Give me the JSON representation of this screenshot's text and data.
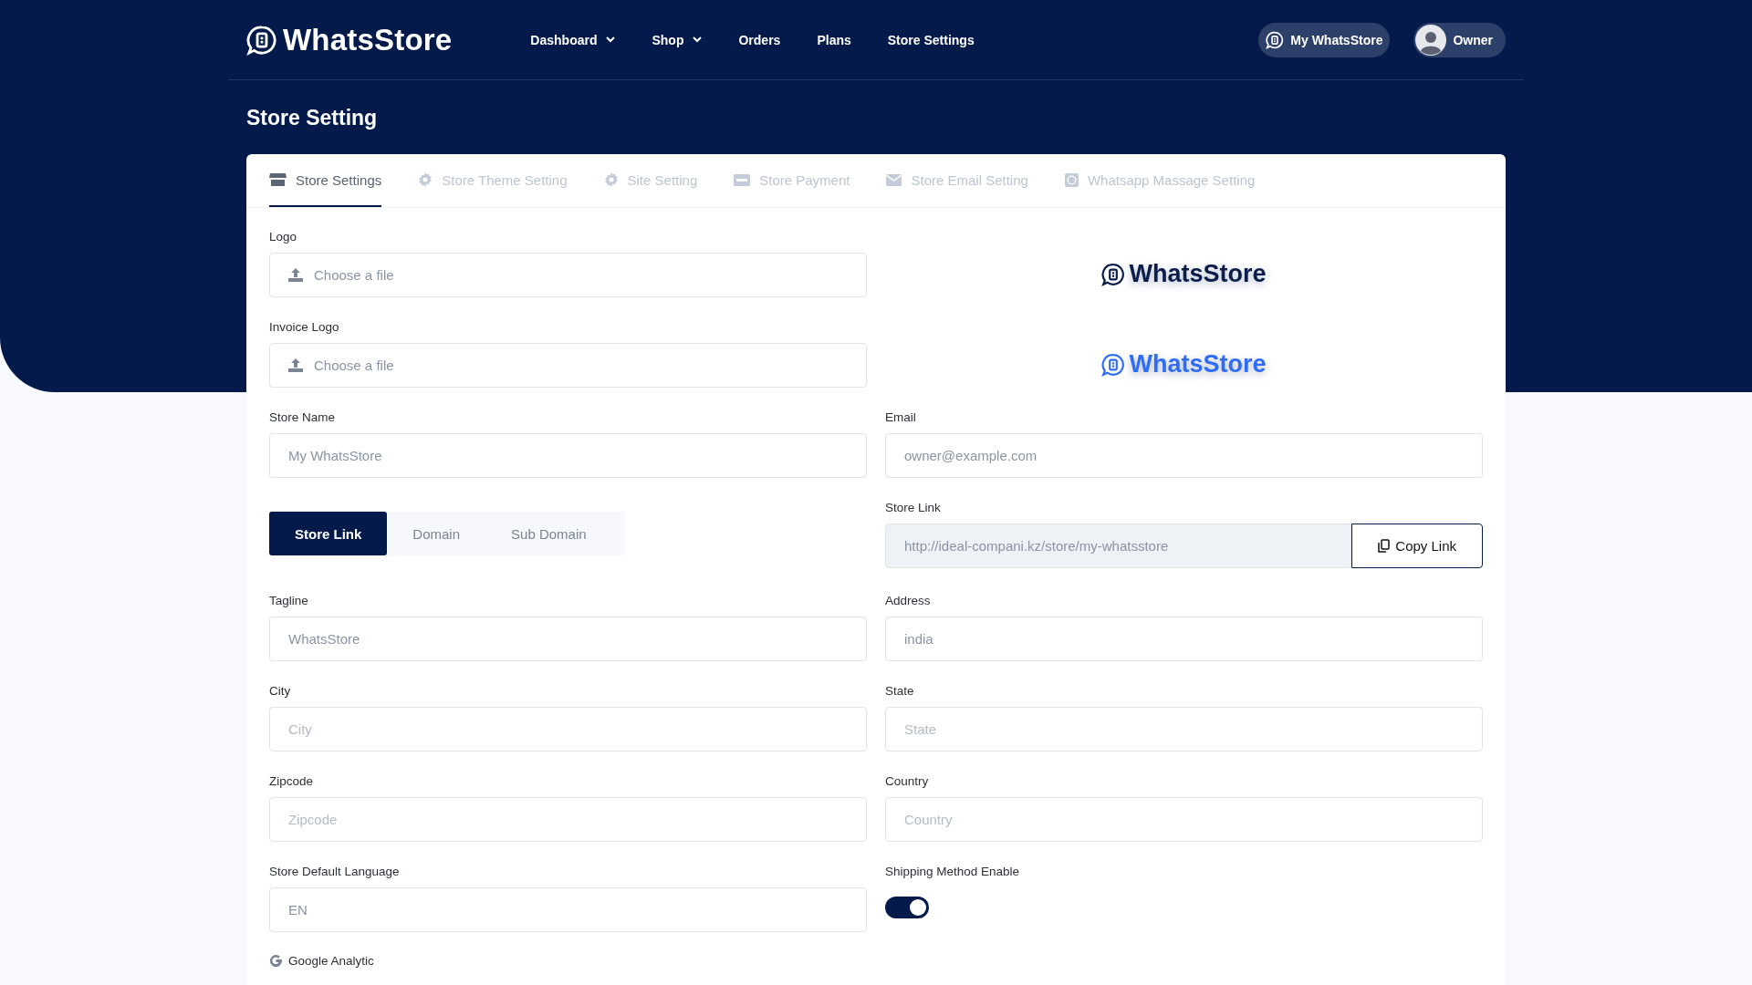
{
  "header": {
    "brand": "WhatsStore",
    "nav": [
      {
        "label": "Dashboard",
        "kind": "dropdown"
      },
      {
        "label": "Shop",
        "kind": "dropdown"
      },
      {
        "label": "Orders",
        "kind": "link"
      },
      {
        "label": "Plans",
        "kind": "link"
      },
      {
        "label": "Store Settings",
        "kind": "link"
      }
    ],
    "store_button": "My WhatsStore",
    "user": "Owner"
  },
  "page_title": "Store Setting",
  "tabs": [
    {
      "label": "Store Settings",
      "kind": "store",
      "selected": true
    },
    {
      "label": "Store Theme Setting",
      "kind": "gear",
      "selected": false
    },
    {
      "label": "Site Setting",
      "kind": "gear",
      "selected": false
    },
    {
      "label": "Store Payment",
      "kind": "card",
      "selected": false
    },
    {
      "label": "Store Email Setting",
      "kind": "mail",
      "selected": false
    },
    {
      "label": "Whatsapp Massage Setting",
      "kind": "chat",
      "selected": false
    }
  ],
  "fields": [
    {
      "kind": "file",
      "label": "Logo",
      "button": "Choose a file"
    },
    {
      "kind": "preview",
      "text": "WhatsStore",
      "color": "#0b1d4a"
    },
    {
      "kind": "file",
      "label": "Invoice Logo",
      "button": "Choose a file"
    },
    {
      "kind": "preview",
      "text": "WhatsStore",
      "color": "#2f6df6"
    },
    {
      "kind": "text",
      "label": "Store Name",
      "value": "My WhatsStore"
    },
    {
      "kind": "text",
      "label": "Email",
      "value": "owner@example.com"
    },
    {
      "kind": "segmented",
      "segments": [
        {
          "label": "Store Link",
          "selected": true
        },
        {
          "label": "Domain",
          "selected": false
        },
        {
          "label": "Sub Domain",
          "selected": false
        }
      ]
    },
    {
      "kind": "link",
      "label": "Store Link",
      "value": "http://ideal-compani.kz/store/my-whatsstore",
      "button": "Copy Link"
    },
    {
      "kind": "text",
      "label": "Tagline",
      "value": "WhatsStore"
    },
    {
      "kind": "text",
      "label": "Address",
      "value": "india"
    },
    {
      "kind": "text",
      "label": "City",
      "placeholder": "City"
    },
    {
      "kind": "text",
      "label": "State",
      "placeholder": "State"
    },
    {
      "kind": "text",
      "label": "Zipcode",
      "placeholder": "Zipcode"
    },
    {
      "kind": "text",
      "label": "Country",
      "placeholder": "Country"
    },
    {
      "kind": "text",
      "label": "Store Default Language",
      "value": "EN"
    },
    {
      "kind": "toggle",
      "label": "Shipping Method Enable",
      "on": true
    },
    {
      "kind": "heading",
      "label": "Google Analytic"
    }
  ]
}
